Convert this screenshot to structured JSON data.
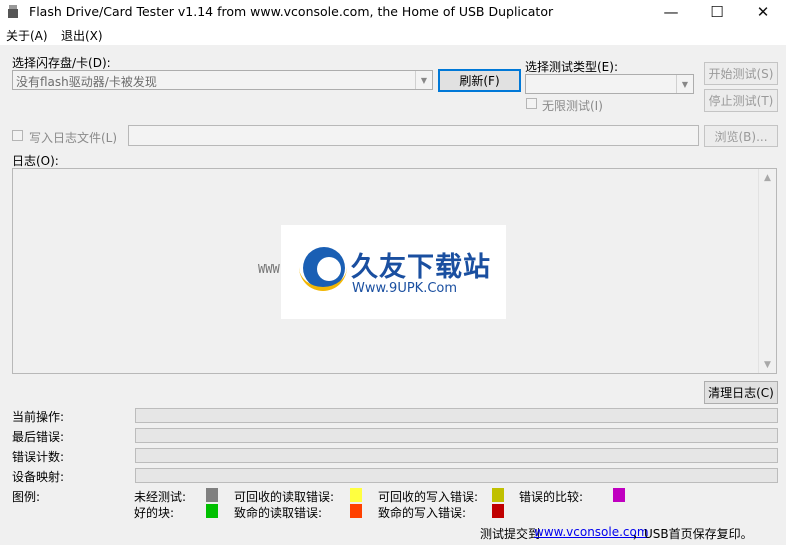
{
  "window": {
    "title": "Flash Drive/Card Tester v1.14 from www.vconsole.com, the Home of USB Duplicator",
    "minimize": "—",
    "maximize": "☐",
    "close": "✕"
  },
  "menu": {
    "about": "关于(A)",
    "exit": "退出(X)"
  },
  "drive": {
    "label": "选择闪存盘/卡(D):",
    "value": "没有flash驱动器/卡被发现",
    "refresh": "刷新(F)"
  },
  "test_type": {
    "label": "选择测试类型(E):",
    "value": "",
    "infinite_label": "无限测试(I)"
  },
  "buttons": {
    "start": "开始测试(S)",
    "stop": "停止测试(T)",
    "browse": "浏览(B)...",
    "clear_log": "清理日志(C)"
  },
  "log": {
    "write_to_file": "写入日志文件(L)",
    "file_path": "",
    "label": "日志(O):"
  },
  "watermark": {
    "cn": "久友下载站",
    "url": "Www.9UPK.Com",
    "side": "WWW.9UPK.COM"
  },
  "status": {
    "current_op": "当前操作:",
    "last_error": "最后错误:",
    "error_count": "错误计数:",
    "device_map": "设备映射:",
    "legend": "图例:"
  },
  "legend": {
    "untested": {
      "label": "未经测试:",
      "color": "#808080"
    },
    "good": {
      "label": "好的块:",
      "color": "#00c000"
    },
    "recoverable_read": {
      "label": "可回收的读取错误:",
      "color": "#ffff40"
    },
    "fatal_read": {
      "label": "致命的读取错误:",
      "color": "#ff4000"
    },
    "recoverable_write": {
      "label": "可回收的写入错误:",
      "color": "#c0c000"
    },
    "fatal_write": {
      "label": "致命的写入错误:",
      "color": "#c00000"
    },
    "compare_error": {
      "label": "错误的比较:",
      "color": "#c000c0"
    }
  },
  "footer": {
    "submit_prefix": "测试提交到",
    "link": "www.vconsole.com",
    "suffix": "，USB首页保存复印。"
  }
}
